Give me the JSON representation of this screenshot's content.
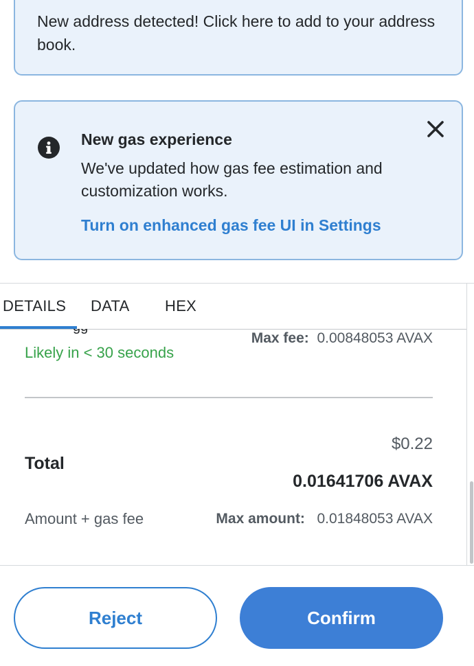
{
  "address_banner": {
    "text": "New address detected! Click here to add to your address book."
  },
  "gas_notice": {
    "icon": "info-icon",
    "title": "New gas experience",
    "body": "We've updated how gas fee estimation and customization works.",
    "link": "Turn on enhanced gas fee UI in Settings",
    "close_icon": "close-icon"
  },
  "tabs": [
    {
      "label": "DETAILS",
      "active": true
    },
    {
      "label": "DATA",
      "active": false
    },
    {
      "label": "HEX",
      "active": false
    }
  ],
  "gas": {
    "likely": "Likely in < 30 seconds",
    "max_fee_label": "Max fee:",
    "max_fee_value": "0.00848053 AVAX"
  },
  "total": {
    "label": "Total",
    "fiat": "$0.22",
    "avax": "0.01641706 AVAX",
    "sublabel": "Amount + gas fee",
    "max_amount_label": "Max amount:",
    "max_amount_value": "0.01848053 AVAX"
  },
  "footer": {
    "reject_label": "Reject",
    "confirm_label": "Confirm"
  },
  "colors": {
    "accent": "#2f7fd0",
    "confirm_bg": "#3d7fd6",
    "notice_bg": "#eaf2fb",
    "notice_border": "#8bb6e0",
    "success": "#37a24a"
  }
}
